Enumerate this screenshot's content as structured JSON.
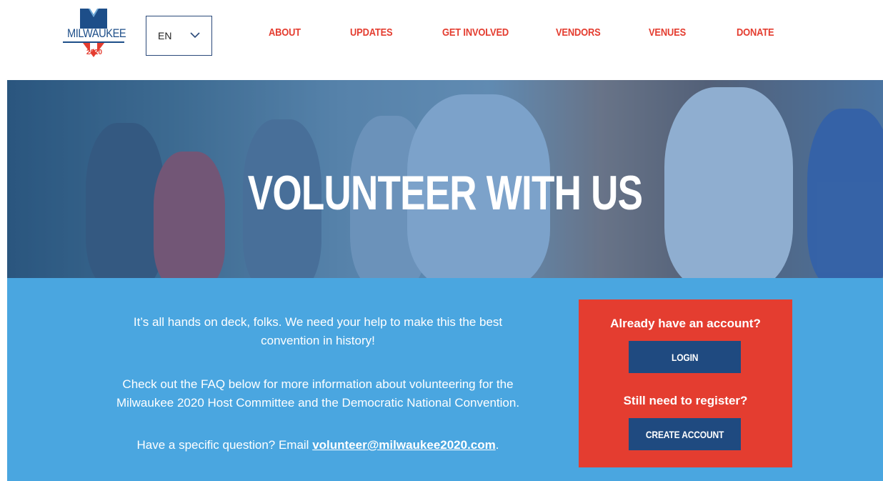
{
  "header": {
    "logo": {
      "wordmark": "MILWAUKEE",
      "year": "2020"
    },
    "language": {
      "selected": "EN"
    },
    "nav": [
      {
        "label": "ABOUT"
      },
      {
        "label": "UPDATES"
      },
      {
        "label": "GET INVOLVED"
      },
      {
        "label": "VENDORS"
      },
      {
        "label": "VENUES"
      },
      {
        "label": "DONATE"
      }
    ]
  },
  "hero": {
    "title": "VOLUNTEER WITH US"
  },
  "intro": {
    "line1": "It’s all hands on deck, folks. We need your help to make this the best",
    "line2": "convention in history!",
    "line3": "Check out the FAQ below for more information about volunteering for the",
    "line4": "Milwaukee 2020 Host Committee and the Democratic National Convention.",
    "question_prefix": "Have a specific question? Email ",
    "email": "volunteer@milwaukee2020.com",
    "question_suffix": "."
  },
  "account_panel": {
    "login_heading": "Already have an account?",
    "login_button": "LOGIN",
    "register_heading": "Still need to register?",
    "register_button": "CREATE ACCOUNT"
  },
  "colors": {
    "brand_red": "#e43d30",
    "brand_navy": "#1f4a80",
    "band_blue": "#4aa6e0"
  }
}
